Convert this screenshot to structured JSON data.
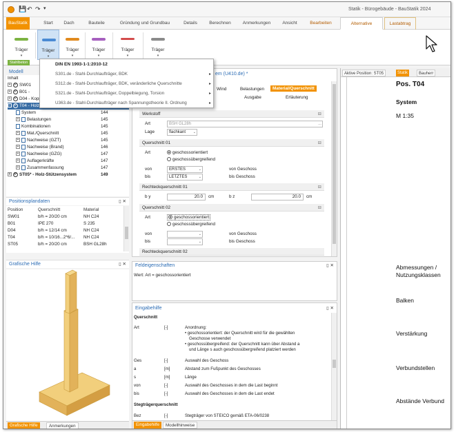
{
  "window_title": "Statik - Bürogebäude - BauStatik 2024",
  "ribbon_tabs": [
    {
      "label": "BauStatik"
    },
    {
      "label": "Start"
    },
    {
      "label": "Dach"
    },
    {
      "label": "Bauteile"
    },
    {
      "label": "Gründung und Grundbau"
    },
    {
      "label": "Details"
    },
    {
      "label": "Berechnen"
    },
    {
      "label": "Anmerkungen"
    },
    {
      "label": "Ansicht"
    },
    {
      "label": "Bearbeiten"
    },
    {
      "label": "Alternative"
    },
    {
      "label": "Lastabtrag"
    }
  ],
  "ribbon_buttons": [
    {
      "label": "Träger",
      "color": "#7cb342"
    },
    {
      "label": "Träger",
      "color": "#4a8ad4"
    },
    {
      "label": "Träger",
      "color": "#e08a1e"
    },
    {
      "label": "Träger",
      "color": "#a65fbf"
    },
    {
      "label": "Träger",
      "color": "#d34b4b"
    },
    {
      "label": "Träger",
      "color": "#8a8a8a"
    }
  ],
  "ribbon_group": "Stahlbeton",
  "dropdown": {
    "header": "DIN EN 1993-1-1:2010-12",
    "items": [
      "S301.de - Stahl-Durchlaufträger, BDK",
      "S312.de - Stahl-Durchlaufträger, BDK, veränderliche Querschnitte",
      "S321.de - Stahl-Durchlaufträger, Doppelbiegung, Torsion",
      "U363.de - Stahl-Durchlaufträger nach Spannungstheorie II. Ordnung"
    ]
  },
  "modell": {
    "title": "Modell",
    "inhalt": "Inhalt",
    "rows": [
      {
        "text": "SW01",
        "num": ""
      },
      {
        "text": "B01 -",
        "num": ""
      },
      {
        "text": "D04 - Koppel-Pfette Dachfläc...",
        "num": "140"
      },
      {
        "text": "T04 - Holz-Balken mit Holz-V...",
        "num": "144"
      },
      {
        "text": "System",
        "num": "144"
      },
      {
        "text": "Belastungen",
        "num": "145"
      },
      {
        "text": "Kombinationen",
        "num": "145"
      },
      {
        "text": "Mat./Querschnitt",
        "num": "145"
      },
      {
        "text": "Nachweise (GZT)",
        "num": "145"
      },
      {
        "text": "Nachweise (Brand)",
        "num": "146"
      },
      {
        "text": "Nachweise (GZG)",
        "num": "147"
      },
      {
        "text": "Auflagerkräfte",
        "num": "147"
      },
      {
        "text": "Zusammenfassung",
        "num": "147"
      },
      {
        "text": "ST05* - Holz-Stützensystem",
        "num": "149"
      }
    ]
  },
  "positionsplan": {
    "title": "Positionsplandaten",
    "headers": [
      "Position",
      "Querschnitt",
      "Material"
    ],
    "rows": [
      [
        "SW01",
        "b/h = 20/20 cm",
        "NH C24"
      ],
      [
        "B01",
        "IPE 270",
        "S 235"
      ],
      [
        "D04",
        "b/h = 12/14 cm",
        "NH C24"
      ],
      [
        "T04",
        "b/h = 10/16...2*6/...",
        "NH C24"
      ],
      [
        "ST05",
        "b/h = 20/20 cm",
        "BSH GL28h"
      ]
    ]
  },
  "grafische_hilfe": {
    "title": "Grafische Hilfe",
    "tabs": [
      "Grafische Hilfe",
      "Anmerkungen"
    ]
  },
  "editor": {
    "title": "em (U410.de) *",
    "tabs_row1": [
      "Wind",
      "Belastungen",
      "Material/Querschnitt"
    ],
    "tabs_row2": [
      "Ausgabe",
      "Erläuterung"
    ],
    "werkstoff": "Werkstoff",
    "art_label": "Art",
    "art_value": "BSH GL28h",
    "lage_label": "Lage",
    "lage_value": "flachkant",
    "qs01": "Querschnitt 01",
    "qs02": "Querschnitt 02",
    "radio1": "geschossorientiert",
    "radio2": "geschossübergreifend",
    "von_label": "von",
    "bis_label": "bis",
    "von_value": "ERSTES",
    "bis_value": "LETZTES",
    "von_geschoss": "von Geschoss",
    "bis_geschoss": "bis Geschoss",
    "rq01": "Rechteckquerschnitt 01",
    "rq02": "Rechteckquerschnitt 02",
    "by_label": "b y",
    "bz_label": "b z",
    "by_value": "20.0",
    "bz_value": "20.0",
    "unit": "cm"
  },
  "feldeigenschaften": {
    "title": "Feldeigenschaften",
    "text": "Wert: Art = geschossorientiert"
  },
  "eingabehilfe": {
    "title": "Eingabehilfe",
    "subtitle": "Querschnitt",
    "rows": [
      {
        "k": "Art",
        "u": "[-]",
        "t": "Anordnung:"
      },
      {
        "k": "",
        "u": "",
        "t": "• geschossorientiert: der Querschnitt wird für die gewählten"
      },
      {
        "k": "",
        "u": "",
        "t": "Geschosse verwendet"
      },
      {
        "k": "",
        "u": "",
        "t": "• geschossübergreifend: der Querschnitt kann über Abstand a"
      },
      {
        "k": "",
        "u": "",
        "t": "und Länge s auch geschossübergreifend platziert werden"
      },
      {
        "k": "Ges",
        "u": "[-]",
        "t": "Auswahl des Geschoss"
      },
      {
        "k": "a",
        "u": "[m]",
        "t": "Abstand zum Fußpunkt des Geschosses"
      },
      {
        "k": "s",
        "u": "[m]",
        "t": "Länge"
      },
      {
        "k": "von",
        "u": "[-]",
        "t": "Auswahl des Geschosses in dem die Last beginnt"
      },
      {
        "k": "bis",
        "u": "[-]",
        "t": "Auswahl des Geschosses in dem die Last endet"
      }
    ],
    "sub2": "Stegträgerquerschnitt",
    "last": {
      "k": "Bez",
      "u": "[-]",
      "t": "Stegträger von STEICO gemäß ETA-06/0238"
    },
    "tabs": [
      "Eingabehilfe",
      "Modellhinweise"
    ]
  },
  "rightpane": {
    "tabs": [
      "Aktive Position: ST05",
      "Statik",
      "Bauherr"
    ],
    "pos": "Pos. T04",
    "system": "System",
    "scale": "M 1:35",
    "labels": [
      "Abmessungen /",
      "Nutzungsklassen",
      "Balken",
      "Verstärkung",
      "Verbundstellen",
      "Abstände Verbund"
    ]
  }
}
